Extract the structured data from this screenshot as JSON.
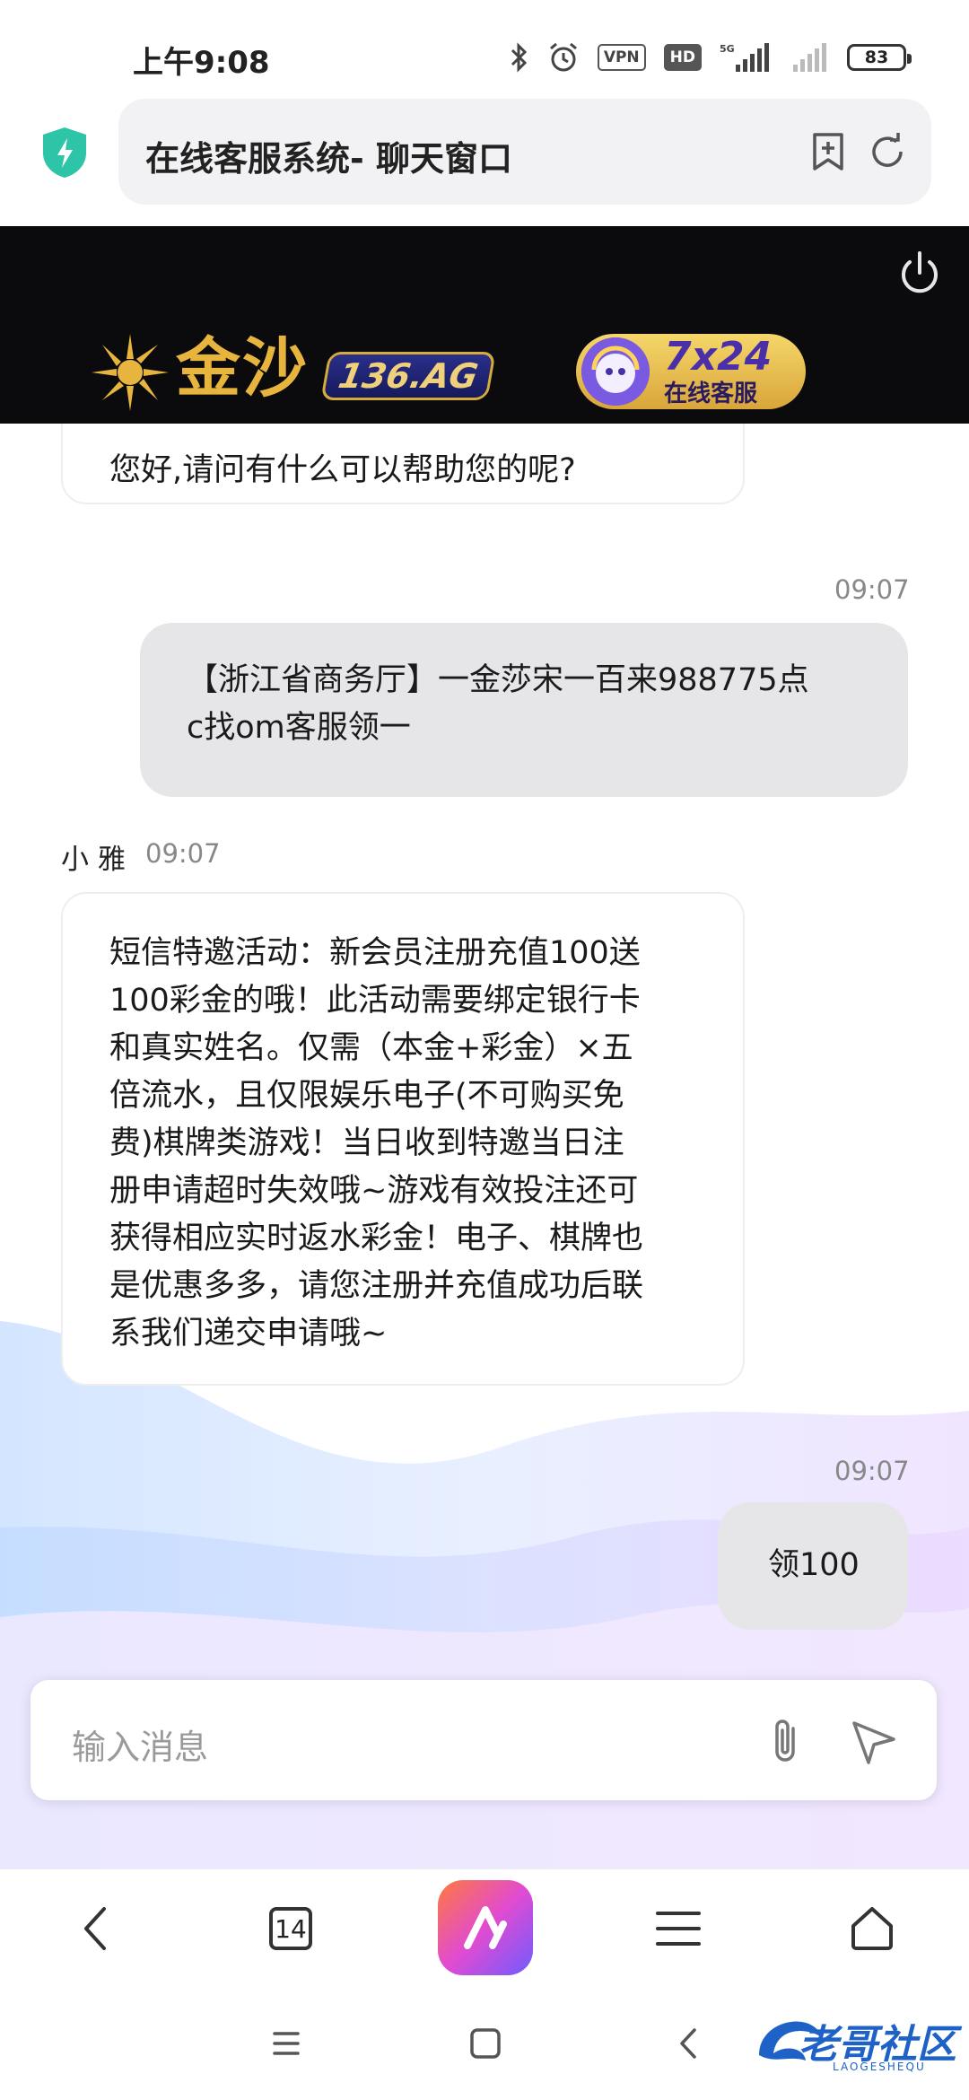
{
  "status_bar": {
    "time": "上午9:08",
    "vpn_label": "VPN",
    "hd_label": "HD",
    "network_label": "5G",
    "battery_level": "83"
  },
  "address_bar": {
    "title": "在线客服系统- 聊天窗口"
  },
  "banner": {
    "logo_text": "金沙",
    "logo_domain": "136.AG",
    "cs_hours": "7x24",
    "cs_label": "在线客服"
  },
  "chat": {
    "messages": [
      {
        "side": "left",
        "text": "您好,请问有什么可以帮助您的呢?"
      },
      {
        "side": "right",
        "time": "09:07",
        "text_lines": [
          "【浙江省商务厅】一金莎宋一百来988775点",
          "c找om客服领一"
        ]
      },
      {
        "side": "left",
        "sender": "小 雅",
        "time": "09:07",
        "text_lines": [
          "短信特邀活动：新会员注册充值100送",
          "100彩金的哦！此活动需要绑定银行卡",
          "和真实姓名。仅需（本金+彩金）×五",
          "倍流水，且仅限娱乐电子(不可购买免",
          "费)棋牌类游戏！当日收到特邀当日注",
          "册申请超时失效哦~游戏有效投注还可",
          "获得相应实时返水彩金！电子、棋牌也",
          "是优惠多多，请您注册并充值成功后联",
          "系我们递交申请哦~"
        ]
      },
      {
        "side": "right",
        "time": "09:07",
        "text": "领100"
      }
    ]
  },
  "input": {
    "placeholder": "输入消息"
  },
  "toolbar": {
    "tabs_count": "14"
  },
  "watermark": {
    "text": "老哥社区",
    "sub": "LAOGESHEQU"
  },
  "colors": {
    "banner_bg": "#0b0b0d",
    "gold": "#e7b53d",
    "bubble_right": "#e6e6e8",
    "accent_shield": "#2ec4a8"
  }
}
